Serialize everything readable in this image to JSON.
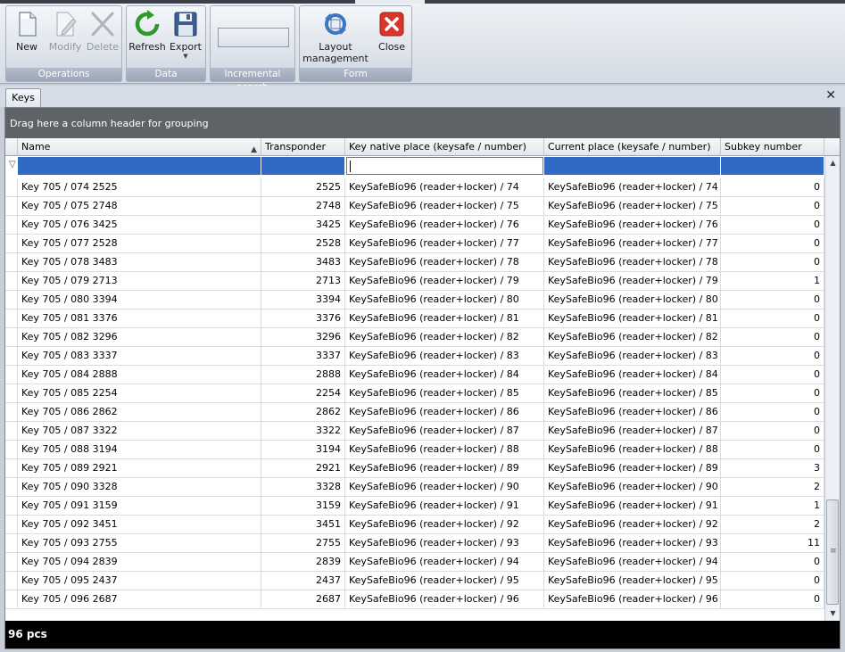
{
  "ribbon": {
    "groups": [
      {
        "label": "Operations",
        "buttons": [
          {
            "label": "New",
            "icon": "new-document-icon",
            "enabled": true
          },
          {
            "label": "Modify",
            "icon": "edit-document-icon",
            "enabled": false
          },
          {
            "label": "Delete",
            "icon": "delete-x-icon",
            "enabled": false
          }
        ]
      },
      {
        "label": "Data",
        "buttons": [
          {
            "label": "Refresh",
            "icon": "refresh-icon",
            "enabled": true
          },
          {
            "label": "Export",
            "icon": "floppy-disk-icon",
            "enabled": true
          }
        ]
      },
      {
        "label": "Incremental search"
      },
      {
        "label": "Form",
        "buttons": [
          {
            "label_line1": "Layout",
            "label_line2": "management",
            "icon": "layout-refresh-icon",
            "enabled": true
          },
          {
            "label": "Close",
            "icon": "close-red-icon",
            "enabled": true
          }
        ]
      }
    ]
  },
  "tabs": [
    "Keys"
  ],
  "grid": {
    "group_hint": "Drag here a column header for grouping",
    "columns": [
      "Name",
      "Transponder",
      "Key native place (keysafe / number)",
      "Current place (keysafe / number)",
      "Subkey number"
    ],
    "sort": {
      "column": "Name",
      "direction": "ascending"
    },
    "rows": [
      [
        "Key 705 / 074 2525",
        "2525",
        "KeySafeBio96 (reader+locker) / 74",
        "KeySafeBio96 (reader+locker) / 74",
        "0"
      ],
      [
        "Key 705 / 075 2748",
        "2748",
        "KeySafeBio96 (reader+locker) / 75",
        "KeySafeBio96 (reader+locker) / 75",
        "0"
      ],
      [
        "Key 705 / 076 3425",
        "3425",
        "KeySafeBio96 (reader+locker) / 76",
        "KeySafeBio96 (reader+locker) / 76",
        "0"
      ],
      [
        "Key 705 / 077 2528",
        "2528",
        "KeySafeBio96 (reader+locker) / 77",
        "KeySafeBio96 (reader+locker) / 77",
        "0"
      ],
      [
        "Key 705 / 078 3483",
        "3483",
        "KeySafeBio96 (reader+locker) / 78",
        "KeySafeBio96 (reader+locker) / 78",
        "0"
      ],
      [
        "Key 705 / 079 2713",
        "2713",
        "KeySafeBio96 (reader+locker) / 79",
        "KeySafeBio96 (reader+locker) / 79",
        "1"
      ],
      [
        "Key 705 / 080 3394",
        "3394",
        "KeySafeBio96 (reader+locker) / 80",
        "KeySafeBio96 (reader+locker) / 80",
        "0"
      ],
      [
        "Key 705 / 081 3376",
        "3376",
        "KeySafeBio96 (reader+locker) / 81",
        "KeySafeBio96 (reader+locker) / 81",
        "0"
      ],
      [
        "Key 705 / 082 3296",
        "3296",
        "KeySafeBio96 (reader+locker) / 82",
        "KeySafeBio96 (reader+locker) / 82",
        "0"
      ],
      [
        "Key 705 / 083 3337",
        "3337",
        "KeySafeBio96 (reader+locker) / 83",
        "KeySafeBio96 (reader+locker) / 83",
        "0"
      ],
      [
        "Key 705 / 084 2888",
        "2888",
        "KeySafeBio96 (reader+locker) / 84",
        "KeySafeBio96 (reader+locker) / 84",
        "0"
      ],
      [
        "Key 705 / 085 2254",
        "2254",
        "KeySafeBio96 (reader+locker) / 85",
        "KeySafeBio96 (reader+locker) / 85",
        "0"
      ],
      [
        "Key 705 / 086 2862",
        "2862",
        "KeySafeBio96 (reader+locker) / 86",
        "KeySafeBio96 (reader+locker) / 86",
        "0"
      ],
      [
        "Key 705 / 087 3322",
        "3322",
        "KeySafeBio96 (reader+locker) / 87",
        "KeySafeBio96 (reader+locker) / 87",
        "0"
      ],
      [
        "Key 705 / 088 3194",
        "3194",
        "KeySafeBio96 (reader+locker) / 88",
        "KeySafeBio96 (reader+locker) / 88",
        "0"
      ],
      [
        "Key 705 / 089 2921",
        "2921",
        "KeySafeBio96 (reader+locker) / 89",
        "KeySafeBio96 (reader+locker) / 89",
        "3"
      ],
      [
        "Key 705 / 090 3328",
        "3328",
        "KeySafeBio96 (reader+locker) / 90",
        "KeySafeBio96 (reader+locker) / 90",
        "2"
      ],
      [
        "Key 705 / 091 3159",
        "3159",
        "KeySafeBio96 (reader+locker) / 91",
        "KeySafeBio96 (reader+locker) / 91",
        "1"
      ],
      [
        "Key 705 / 092 3451",
        "3451",
        "KeySafeBio96 (reader+locker) / 92",
        "KeySafeBio96 (reader+locker) / 92",
        "2"
      ],
      [
        "Key 705 / 093 2755",
        "2755",
        "KeySafeBio96 (reader+locker) / 93",
        "KeySafeBio96 (reader+locker) / 93",
        "11"
      ],
      [
        "Key 705 / 094 2839",
        "2839",
        "KeySafeBio96 (reader+locker) / 94",
        "KeySafeBio96 (reader+locker) / 94",
        "0"
      ],
      [
        "Key 705 / 095 2437",
        "2437",
        "KeySafeBio96 (reader+locker) / 95",
        "KeySafeBio96 (reader+locker) / 95",
        "0"
      ],
      [
        "Key 705 / 096 2687",
        "2687",
        "KeySafeBio96 (reader+locker) / 96",
        "KeySafeBio96 (reader+locker) / 96",
        "0"
      ]
    ],
    "footer": "96 pcs"
  }
}
